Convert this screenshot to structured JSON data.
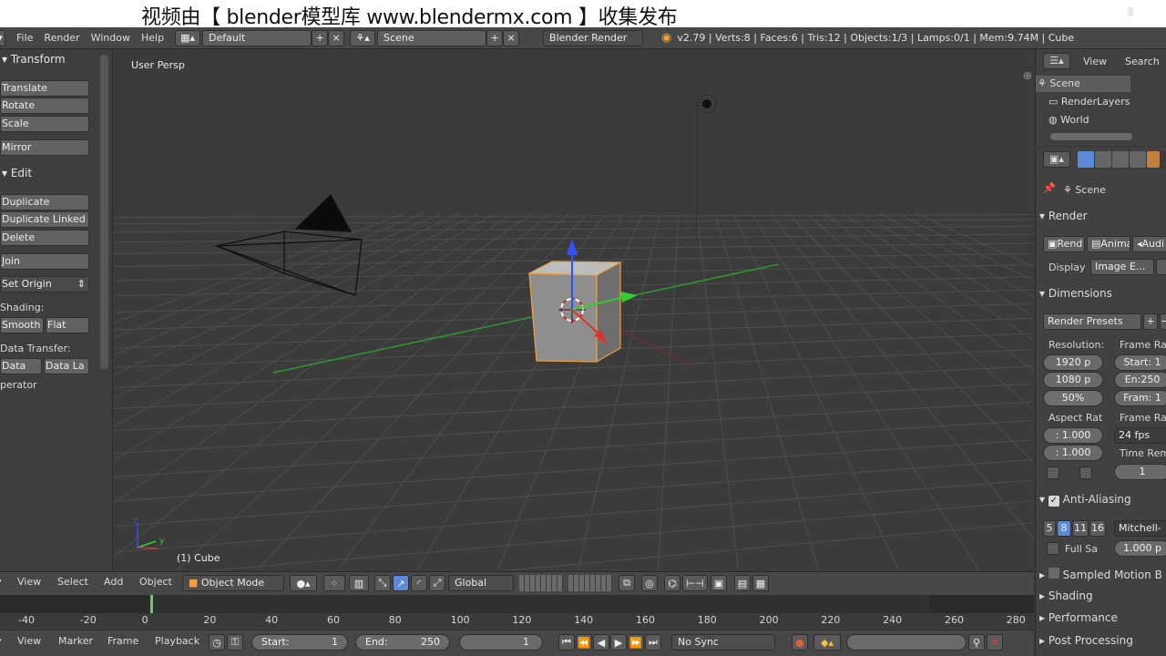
{
  "watermark": {
    "text": "视频由【 blender模型库 www.blendermx.com 】收集发布"
  },
  "menubar": {
    "items": [
      "File",
      "Render",
      "Window",
      "Help"
    ],
    "layout": "Default",
    "scene": "Scene",
    "engine": "Blender Render",
    "stats": "v2.79 | Verts:8 | Faces:6 | Tris:12 | Objects:1/3 | Lamps:0/1 | Mem:9.74M | Cube"
  },
  "toolshelf": {
    "transform_header": "Transform",
    "translate": "Translate",
    "rotate": "Rotate",
    "scale": "Scale",
    "mirror": "Mirror",
    "edit_header": "Edit",
    "duplicate": "Duplicate",
    "duplicate_linked": "Duplicate Linked",
    "delete": "Delete",
    "join": "Join",
    "set_origin": "Set Origin",
    "shading_label": "Shading:",
    "smooth": "Smooth",
    "flat": "Flat",
    "data_transfer_label": "Data Transfer:",
    "data": "Data",
    "data_la": "Data La",
    "operator": "perator"
  },
  "viewport": {
    "view_label": "User Persp",
    "object_label": "(1) Cube"
  },
  "outliner": {
    "view": "View",
    "search": "Search",
    "items": [
      "Scene",
      "RenderLayers",
      "World"
    ]
  },
  "properties": {
    "scene_path": "Scene",
    "render_header": "Render",
    "render_btns": [
      "Rend",
      "Anima",
      "Audi"
    ],
    "display_label": "Display",
    "display_value": "Image E...",
    "dimensions_header": "Dimensions",
    "render_presets": "Render Presets",
    "resolution_label": "Resolution:",
    "frame_range_label": "Frame Ra",
    "res_x": "1920 p",
    "res_y": "1080 p",
    "res_pct": "50%",
    "start": "Start: 1",
    "end": "En:250",
    "fram": "Fram: 1",
    "aspect_label": "Aspect Rat",
    "frame_rate_label": "Frame Rat",
    "aspect_x": ": 1.000",
    "aspect_y": ": 1.000",
    "fps": "24 fps",
    "time_rem": "Time Rem",
    "time_val": "1",
    "aa_header": "Anti-Aliasing",
    "aa_samples": [
      "5",
      "8",
      "11",
      "16"
    ],
    "aa_filter": "Mitchell-",
    "full_sample": "Full Sa",
    "filter_size": "1.000 p",
    "collapsed": [
      "Sampled Motion B",
      "Shading",
      "Performance",
      "Post Processing"
    ]
  },
  "view3d_header": {
    "menus": [
      "View",
      "Select",
      "Add",
      "Object"
    ],
    "mode": "Object Mode",
    "orientation": "Global"
  },
  "timeline": {
    "ticks": [
      "-40",
      "-20",
      "0",
      "20",
      "40",
      "60",
      "80",
      "100",
      "120",
      "140",
      "160",
      "180",
      "200",
      "220",
      "240",
      "260",
      "280"
    ],
    "menus": [
      "View",
      "Marker",
      "Frame",
      "Playback"
    ],
    "start": "Start:",
    "start_val": "1",
    "end": "End:",
    "end_val": "250",
    "current": "1",
    "sync": "No Sync"
  },
  "colors": {
    "header": "#474747",
    "viewport_bg": "#3b3b3b",
    "selected_outline": "#f0a040",
    "x_axis": "#e03030",
    "y_axis": "#30d030",
    "z_axis": "#3050ff",
    "accent_blue": "#5a8ad8"
  }
}
